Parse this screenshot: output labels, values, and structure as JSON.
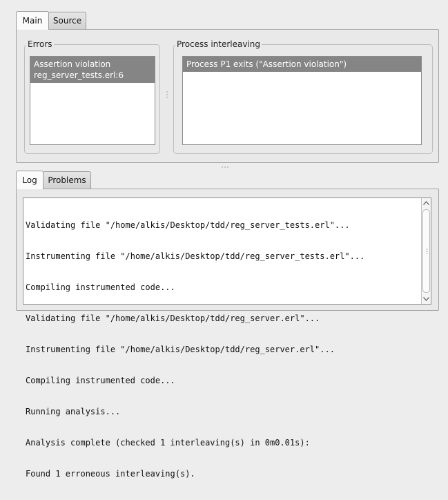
{
  "top_tabs": [
    {
      "label": "Main",
      "active": true
    },
    {
      "label": "Source",
      "active": false
    }
  ],
  "errors": {
    "title": "Errors",
    "items": [
      {
        "line1": "Assertion violation",
        "line2": "reg_server_tests.erl:6",
        "selected": true
      }
    ]
  },
  "interleaving": {
    "title": "Process interleaving",
    "items": [
      {
        "text": "Process P1 exits (\"Assertion violation\")",
        "selected": true
      }
    ]
  },
  "bottom_tabs": [
    {
      "label": "Log",
      "active": true
    },
    {
      "label": "Problems",
      "active": false
    }
  ],
  "log": {
    "lines": [
      "Validating file \"/home/alkis/Desktop/tdd/reg_server_tests.erl\"...",
      "Instrumenting file \"/home/alkis/Desktop/tdd/reg_server_tests.erl\"...",
      "Compiling instrumented code...",
      "Validating file \"/home/alkis/Desktop/tdd/reg_server.erl\"...",
      "Instrumenting file \"/home/alkis/Desktop/tdd/reg_server.erl\"...",
      "Compiling instrumented code...",
      "Running analysis...",
      "Analysis complete (checked 1 interleaving(s) in 0m0.01s):",
      "Found 1 erroneous interleaving(s)."
    ]
  },
  "icons": {
    "scroll_up": "scroll-up-arrow-icon",
    "scroll_down": "scroll-down-arrow-icon",
    "splitter": "splitter-grip-icon"
  }
}
